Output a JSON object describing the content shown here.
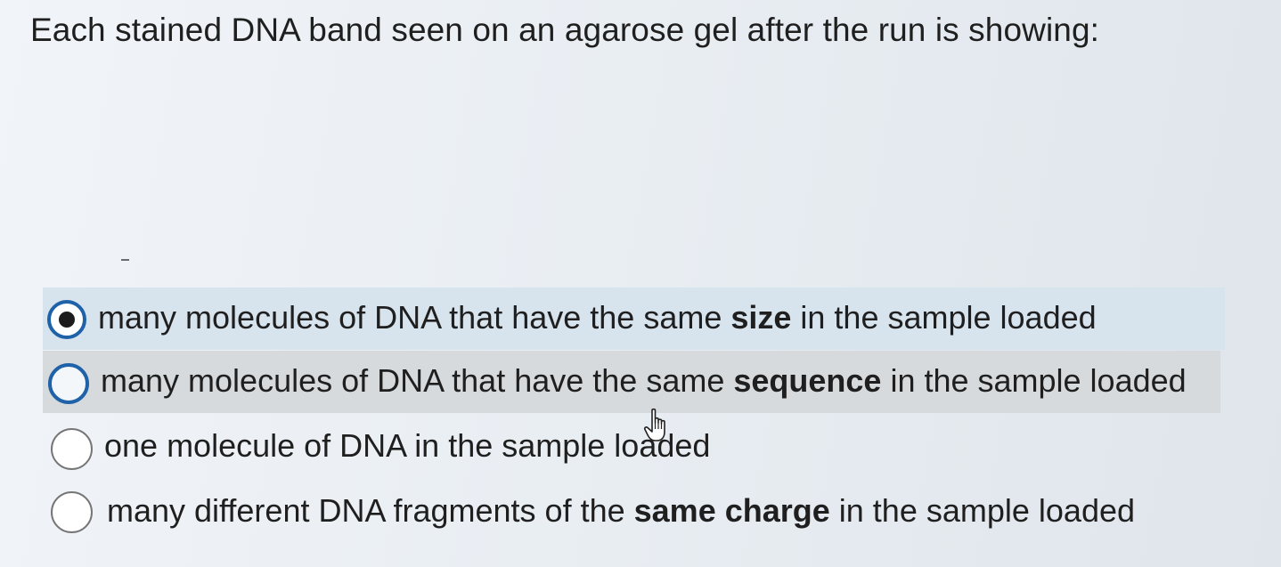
{
  "question": {
    "text": "Each stained DNA band seen on an agarose gel after the run is showing:"
  },
  "options": [
    {
      "state": "selected",
      "before": "many molecules of DNA that have the same ",
      "bold": "size",
      "after": " in the sample loaded"
    },
    {
      "state": "hovered",
      "before": "many molecules of DNA that have the same ",
      "bold": "sequence",
      "after": " in the sample loaded"
    },
    {
      "state": "unselected",
      "before": "one molecule of DNA in the sample loaded",
      "bold": "",
      "after": ""
    },
    {
      "state": "unselected",
      "before": "many different DNA fragments of the ",
      "bold": "same charge",
      "after": " in the sample loaded"
    }
  ],
  "colors": {
    "selected_background": "#d7e3ed",
    "hover_background": "#d6dadd",
    "radio_accent": "#1f62a8",
    "text": "#1f1f1f"
  },
  "cursor": {
    "icon": "hand-pointer-icon"
  }
}
